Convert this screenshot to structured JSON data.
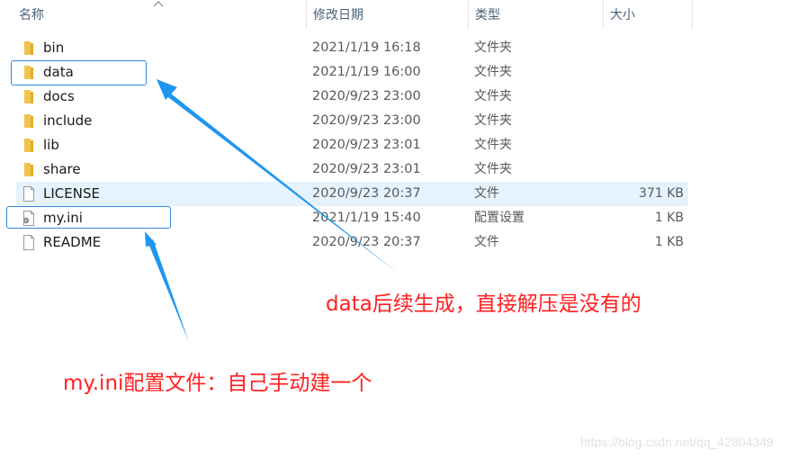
{
  "columns": {
    "name": "名称",
    "date": "修改日期",
    "type": "类型",
    "size": "大小"
  },
  "sort": {
    "column": "name",
    "direction": "ascending",
    "icon": "chevron-up-icon"
  },
  "files": [
    {
      "name": "bin",
      "date": "2021/1/19 16:18",
      "type": "文件夹",
      "size": "",
      "icon": "folder-icon"
    },
    {
      "name": "data",
      "date": "2021/1/19 16:00",
      "type": "文件夹",
      "size": "",
      "icon": "folder-icon"
    },
    {
      "name": "docs",
      "date": "2020/9/23 23:00",
      "type": "文件夹",
      "size": "",
      "icon": "folder-icon"
    },
    {
      "name": "include",
      "date": "2020/9/23 23:00",
      "type": "文件夹",
      "size": "",
      "icon": "folder-icon"
    },
    {
      "name": "lib",
      "date": "2020/9/23 23:01",
      "type": "文件夹",
      "size": "",
      "icon": "folder-icon"
    },
    {
      "name": "share",
      "date": "2020/9/23 23:01",
      "type": "文件夹",
      "size": "",
      "icon": "folder-icon"
    },
    {
      "name": "LICENSE",
      "date": "2020/9/23 20:37",
      "type": "文件",
      "size": "371 KB",
      "icon": "file-icon",
      "hovered": true
    },
    {
      "name": "my.ini",
      "date": "2021/1/19 15:40",
      "type": "配置设置",
      "size": "1 KB",
      "icon": "config-file-icon"
    },
    {
      "name": "README",
      "date": "2020/9/23 20:37",
      "type": "文件",
      "size": "1 KB",
      "icon": "file-icon"
    }
  ],
  "annotations": {
    "data_note": "data后续生成，直接解压是没有的",
    "ini_note": "my.ini配置文件：自己手动建一个",
    "annotation_color": "#ff2020",
    "arrow_color": "#1e96f0"
  },
  "watermark": "https://blog.csdn.net/qq_42804349"
}
